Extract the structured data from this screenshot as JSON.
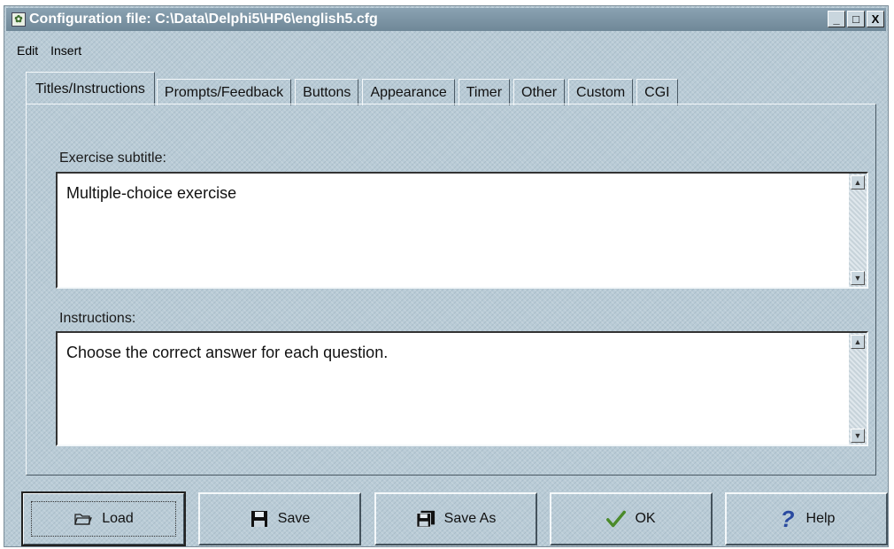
{
  "window": {
    "title": "Configuration file: C:\\Data\\Delphi5\\HP6\\english5.cfg",
    "controls": {
      "minimize": "_",
      "maximize": "□",
      "close": "X"
    }
  },
  "menu": {
    "edit": "Edit",
    "insert": "Insert"
  },
  "tabs": [
    {
      "label": "Titles/Instructions",
      "active": true
    },
    {
      "label": "Prompts/Feedback",
      "active": false
    },
    {
      "label": "Buttons",
      "active": false
    },
    {
      "label": "Appearance",
      "active": false
    },
    {
      "label": "Timer",
      "active": false
    },
    {
      "label": "Other",
      "active": false
    },
    {
      "label": "Custom",
      "active": false
    },
    {
      "label": "CGI",
      "active": false
    }
  ],
  "fields": {
    "subtitle": {
      "label": "Exercise subtitle:",
      "value": "Multiple-choice exercise"
    },
    "instructions": {
      "label": "Instructions:",
      "value": "Choose the correct answer for each question."
    }
  },
  "buttons": {
    "load": {
      "label": "Load",
      "icon": "folder-open-icon"
    },
    "save": {
      "label": "Save",
      "icon": "floppy-disk-icon"
    },
    "save_as": {
      "label": "Save As",
      "icon": "floppy-disks-icon"
    },
    "ok": {
      "label": "OK",
      "icon": "checkmark-icon"
    },
    "help": {
      "label": "Help",
      "icon": "question-mark-icon"
    }
  },
  "colors": {
    "window_bg": "#b9cbd6",
    "titlebar": "#7890a0",
    "ok_check": "#4a8a2a",
    "help_mark": "#2a4aa0"
  }
}
